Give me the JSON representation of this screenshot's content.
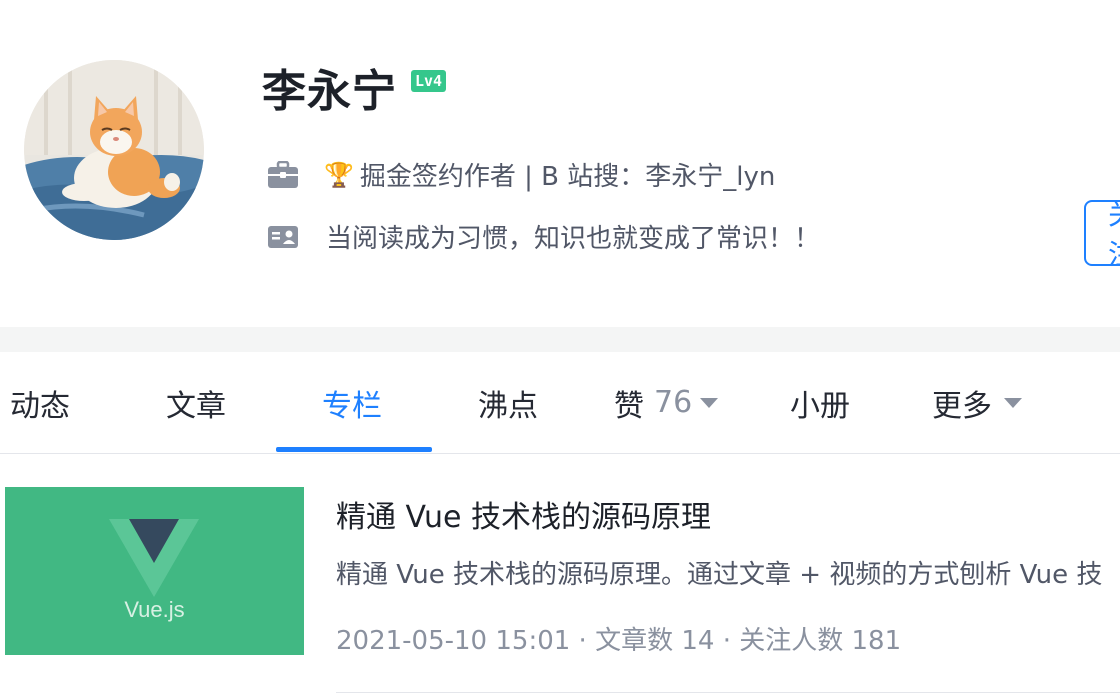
{
  "profile": {
    "name": "李永宁",
    "level": "Lv4",
    "badge_text": "掘金签约作者 | B 站搜：李永宁_lyn",
    "bio": "当阅读成为习惯，知识也就变成了常识！！",
    "follow_label": "关注"
  },
  "tabs": [
    {
      "label": "动态"
    },
    {
      "label": "文章"
    },
    {
      "label": "专栏",
      "active": true
    },
    {
      "label": "沸点"
    },
    {
      "label": "赞",
      "count": "76"
    },
    {
      "label": "小册"
    },
    {
      "label": "更多"
    }
  ],
  "column": {
    "title": "精通 Vue 技术栈的源码原理",
    "description": "精通 Vue 技术栈的源码原理。通过文章 + 视频的方式刨析 Vue 技",
    "meta": "2021-05-10 15:01 · 文章数 14 · 关注人数 181",
    "cover_label": "Vue.js"
  },
  "colors": {
    "accent": "#1e80ff",
    "level_badge": "#35c78c",
    "vue_green": "#41b883",
    "vue_dark": "#35495e"
  },
  "icons": {
    "job": "briefcase-icon",
    "bio": "id-card-icon",
    "trophy": "trophy-icon",
    "dropdown": "caret-down-icon"
  }
}
